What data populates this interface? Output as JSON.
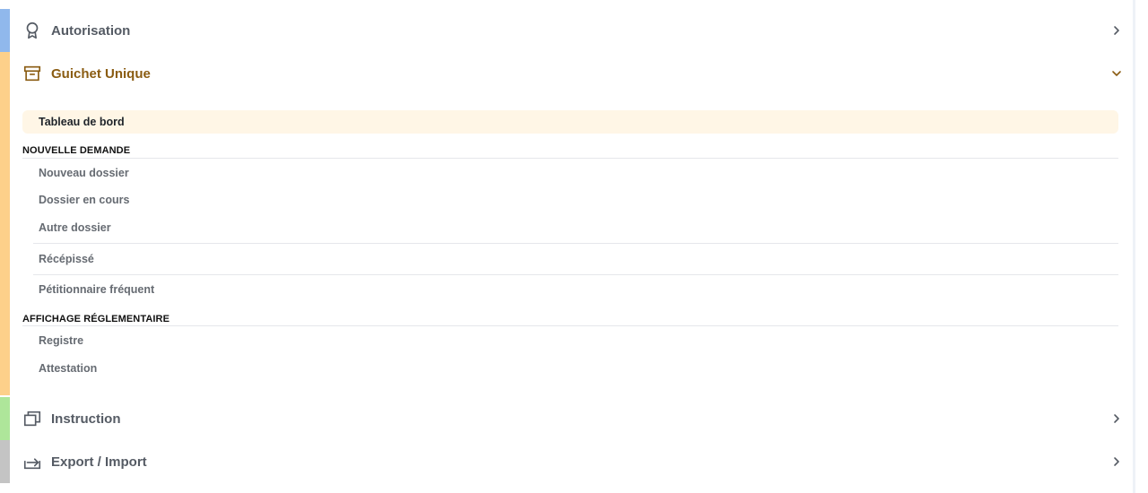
{
  "sections": {
    "autorisation": {
      "label": "Autorisation",
      "icon": "award-icon",
      "state": "collapsed"
    },
    "guichet": {
      "label": "Guichet Unique",
      "icon": "archive-box-icon",
      "state": "expanded"
    },
    "instruction": {
      "label": "Instruction",
      "icon": "copy-icon",
      "state": "collapsed"
    },
    "export": {
      "label": "Export / Import",
      "icon": "export-arrow-icon",
      "state": "collapsed"
    }
  },
  "guichet_menu": {
    "dashboard": "Tableau de bord",
    "group_nouvelle_demande": "NOUVELLE DEMANDE",
    "nouveau_dossier": "Nouveau dossier",
    "dossier_en_cours": "Dossier en cours",
    "autre_dossier": "Autre dossier",
    "recepisse": "Récépissé",
    "petitionnaire": "Pétitionnaire fréquent",
    "group_affichage": "AFFICHAGE RÉGLEMENTAIRE",
    "registre": "Registre",
    "attestation": "Attestation"
  },
  "colors": {
    "accent_autorisation": "#90b8ec",
    "accent_guichet": "#fdd08a",
    "accent_instruction": "#aee69a",
    "accent_export": "#c4c4c4",
    "active_text": "#8a5c12",
    "selected_bg": "#fff6e6"
  }
}
